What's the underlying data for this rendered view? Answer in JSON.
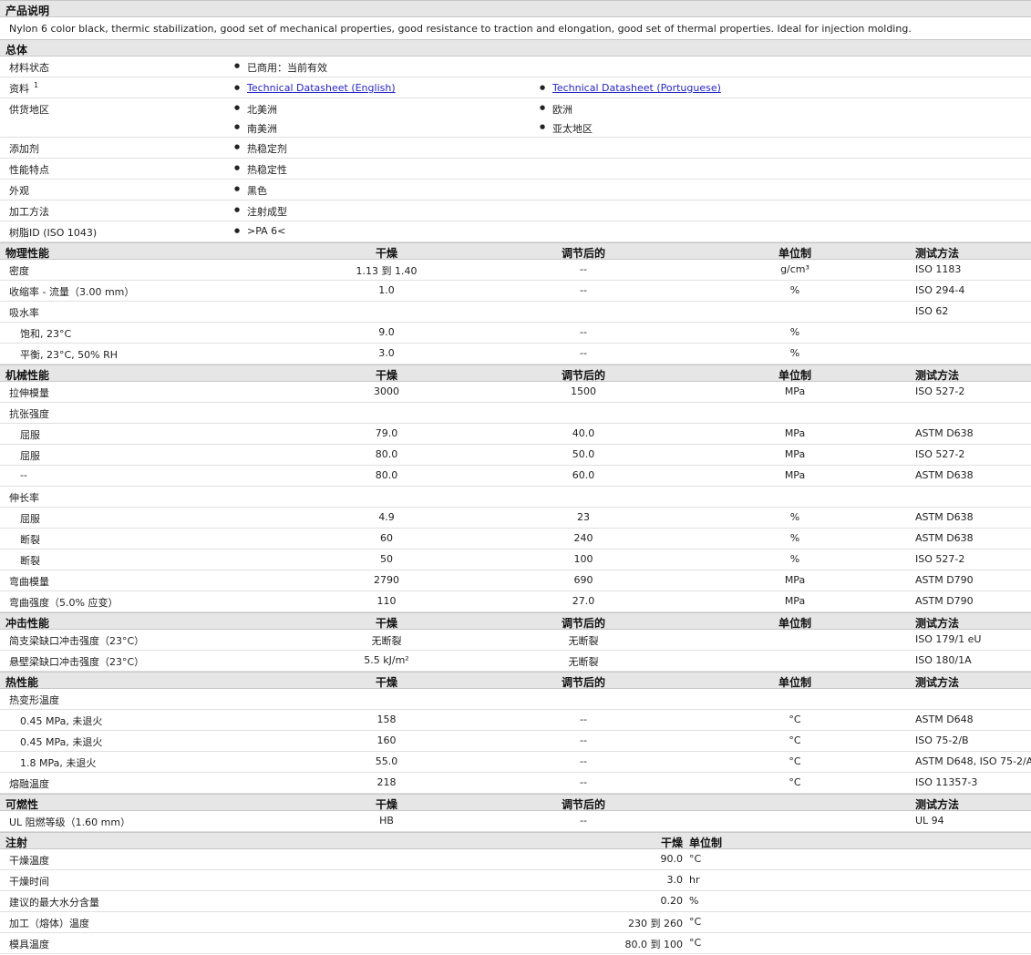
{
  "product_description": {
    "header": "产品说明",
    "text": "Nylon 6 color black, thermic stabilization, good set of mechanical properties, good resistance to traction and elongation, good set of thermal properties. Ideal for injection molding."
  },
  "general": {
    "header": "总体",
    "material_status_label": "材料状态",
    "material_status_value": "已商用：当前有效",
    "docs_label": "资料",
    "docs_sup": "1",
    "doc_link_en": "Technical Datasheet (English)",
    "doc_link_pt": "Technical Datasheet (Portuguese)",
    "supply_label": "供货地区",
    "supply_1": "北美洲",
    "supply_2": "欧洲",
    "supply_3": "南美洲",
    "supply_4": "亚太地区",
    "additive_label": "添加剂",
    "additive_value": "热稳定剂",
    "features_label": "性能特点",
    "features_value": "热稳定性",
    "appearance_label": "外观",
    "appearance_value": "黑色",
    "processing_label": "加工方法",
    "processing_value": "注射成型",
    "resin_label": "树脂ID (ISO 1043)",
    "resin_value": ">PA 6<"
  },
  "col": {
    "dry": "干燥",
    "cond": "调节后的",
    "unit": "单位制",
    "method": "测试方法"
  },
  "physical": {
    "header": "物理性能",
    "rows": [
      {
        "label": "密度",
        "dry": "1.13 到  1.40",
        "cond": "--",
        "unit": "g/cm³",
        "method": "ISO 1183"
      },
      {
        "label": "收缩率  - 流量（3.00 mm）",
        "dry": "1.0",
        "cond": "--",
        "unit": "%",
        "method": "ISO 294-4"
      },
      {
        "label": "吸水率",
        "dry": "",
        "cond": "",
        "unit": "",
        "method": "ISO 62"
      },
      {
        "label": "饱和, 23°C",
        "dry": "9.0",
        "cond": "--",
        "unit": "%",
        "method": ""
      },
      {
        "label": "平衡, 23°C, 50% RH",
        "dry": "3.0",
        "cond": "--",
        "unit": "%",
        "method": ""
      }
    ]
  },
  "mechanical": {
    "header": "机械性能",
    "rows": [
      {
        "label": "拉伸模量",
        "dry": "3000",
        "cond": "1500",
        "unit": "MPa",
        "method": "ISO 527-2"
      },
      {
        "label": "抗张强度",
        "dry": "",
        "cond": "",
        "unit": "",
        "method": ""
      },
      {
        "label": "屈服",
        "dry": "79.0",
        "cond": "40.0",
        "unit": "MPa",
        "method": "ASTM D638"
      },
      {
        "label": "屈服",
        "dry": "80.0",
        "cond": "50.0",
        "unit": "MPa",
        "method": "ISO 527-2"
      },
      {
        "label": "--",
        "dry": "80.0",
        "cond": "60.0",
        "unit": "MPa",
        "method": "ASTM D638"
      },
      {
        "label": "伸长率",
        "dry": "",
        "cond": "",
        "unit": "",
        "method": ""
      },
      {
        "label": "屈服",
        "dry": "4.9",
        "cond": "23",
        "unit": "%",
        "method": "ASTM D638"
      },
      {
        "label": "断裂",
        "dry": "60",
        "cond": "240",
        "unit": "%",
        "method": "ASTM D638"
      },
      {
        "label": "断裂",
        "dry": "50",
        "cond": "100",
        "unit": "%",
        "method": "ISO 527-2"
      },
      {
        "label": "弯曲模量",
        "dry": "2790",
        "cond": "690",
        "unit": "MPa",
        "method": "ASTM D790"
      },
      {
        "label": "弯曲强度（5.0% 应变）",
        "dry": "110",
        "cond": "27.0",
        "unit": "MPa",
        "method": "ASTM D790"
      }
    ]
  },
  "impact": {
    "header": "冲击性能",
    "rows": [
      {
        "label": "简支梁缺口冲击强度（23°C）",
        "dry": "无断裂",
        "cond": "无断裂",
        "unit": "",
        "method": "ISO 179/1 eU"
      },
      {
        "label": "悬壁梁缺口冲击强度（23°C）",
        "dry": "5.5 kJ/m²",
        "cond": "无断裂",
        "unit": "",
        "method": "ISO 180/1A"
      }
    ]
  },
  "thermal": {
    "header": "热性能",
    "rows": [
      {
        "label": "热变形温度",
        "dry": "",
        "cond": "",
        "unit": "",
        "method": ""
      },
      {
        "label": "0.45 MPa, 未退火",
        "dry": "158",
        "cond": "--",
        "unit": "°C",
        "method": "ASTM D648"
      },
      {
        "label": "0.45 MPa, 未退火",
        "dry": "160",
        "cond": "--",
        "unit": "°C",
        "method": "ISO 75-2/B"
      },
      {
        "label": "1.8 MPa, 未退火",
        "dry": "55.0",
        "cond": "--",
        "unit": "°C",
        "method": "ASTM D648, ISO 75-2/A"
      },
      {
        "label": "熔融温度",
        "dry": "218",
        "cond": "--",
        "unit": "°C",
        "method": "ISO 11357-3"
      }
    ]
  },
  "flammability": {
    "header": "可燃性",
    "rows": [
      {
        "label": "UL 阻燃等级（1.60 mm）",
        "dry": "HB",
        "cond": "--",
        "unit": "",
        "method": "UL 94"
      }
    ]
  },
  "injection": {
    "header": "注射",
    "col_dry": "干燥",
    "col_unit": "单位制",
    "rows": [
      {
        "label": "干燥温度",
        "value": "90.0",
        "unit": "°C"
      },
      {
        "label": "干燥时间",
        "value": "3.0",
        "unit": "hr"
      },
      {
        "label": "建议的最大水分含量",
        "value": "0.20",
        "unit": "%"
      },
      {
        "label": "加工（熔体）温度",
        "value": "230 到  260",
        "unit": "°C"
      },
      {
        "label": "模具温度",
        "value": "80.0 到  100",
        "unit": "°C"
      }
    ]
  }
}
